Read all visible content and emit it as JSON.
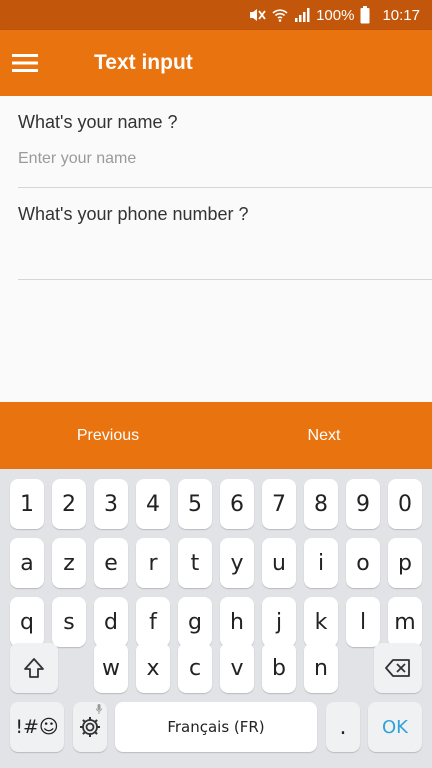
{
  "status_bar": {
    "battery": "100%",
    "time": "10:17",
    "icons": [
      "mute-icon",
      "wifi-icon",
      "signal-icon",
      "battery-icon"
    ]
  },
  "app_bar": {
    "title": "Text input",
    "menu_icon": "hamburger-menu-icon"
  },
  "form": {
    "name_label": "What's your name ?",
    "name_placeholder": "Enter your name",
    "name_value": "",
    "phone_label": "What's your phone number ?",
    "phone_value": ""
  },
  "nav": {
    "previous": "Previous",
    "next": "Next"
  },
  "keyboard": {
    "row1": [
      "1",
      "2",
      "3",
      "4",
      "5",
      "6",
      "7",
      "8",
      "9",
      "0"
    ],
    "row2": [
      "a",
      "z",
      "e",
      "r",
      "t",
      "y",
      "u",
      "i",
      "o",
      "p"
    ],
    "row3": [
      "q",
      "s",
      "d",
      "f",
      "g",
      "h",
      "j",
      "k",
      "l",
      "m"
    ],
    "row4": [
      "w",
      "x",
      "c",
      "v",
      "b",
      "n"
    ],
    "shift_icon": "shift-arrow-icon",
    "backspace_icon": "backspace-icon",
    "symbols_label": "!#☺",
    "settings_icon": "gear-icon",
    "space_label": "Français (FR)",
    "period_label": ".",
    "ok_label": "OK"
  },
  "colors": {
    "status_bar": "#c2560a",
    "accent": "#e8730f",
    "ok_text": "#2fa3d8",
    "keyboard_bg": "#e1e3e6"
  }
}
